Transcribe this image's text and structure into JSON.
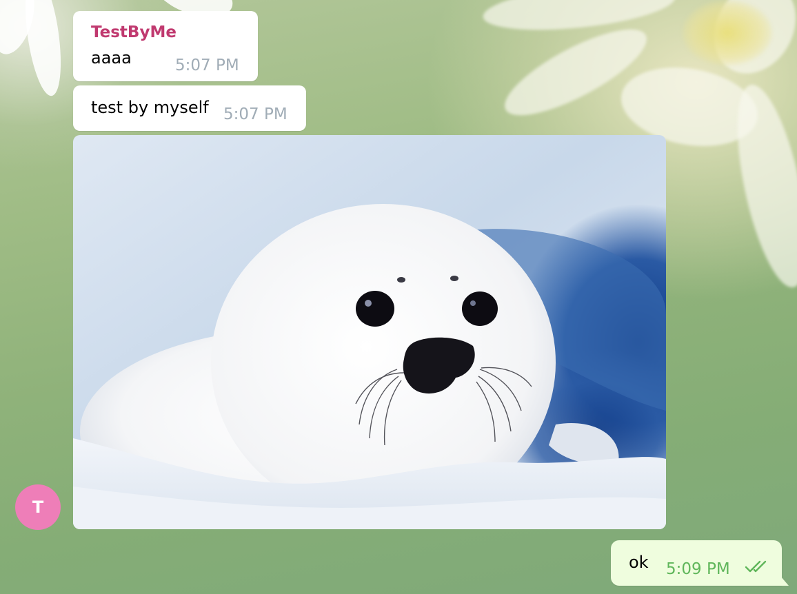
{
  "messages": [
    {
      "id": "m1",
      "direction": "incoming",
      "sender": "TestByMe",
      "text": "aaaa",
      "time": "5:07 PM"
    },
    {
      "id": "m2",
      "direction": "incoming",
      "text": "test by myself",
      "time": "5:07 PM"
    },
    {
      "id": "m3",
      "direction": "incoming",
      "type": "photo",
      "photo_subject": "white baby harp seal lying on snow"
    },
    {
      "id": "m4",
      "direction": "outgoing",
      "text": "ok",
      "time": "5:09 PM",
      "status_icon": "double-check-icon"
    }
  ],
  "avatar": {
    "initial": "T",
    "color": "#ee7eb8"
  },
  "colors": {
    "sender_name": "#c0396f",
    "incoming_bubble": "#ffffff",
    "outgoing_bubble": "#effdde",
    "incoming_time": "#a0acb6",
    "outgoing_time": "#5fb65a"
  }
}
